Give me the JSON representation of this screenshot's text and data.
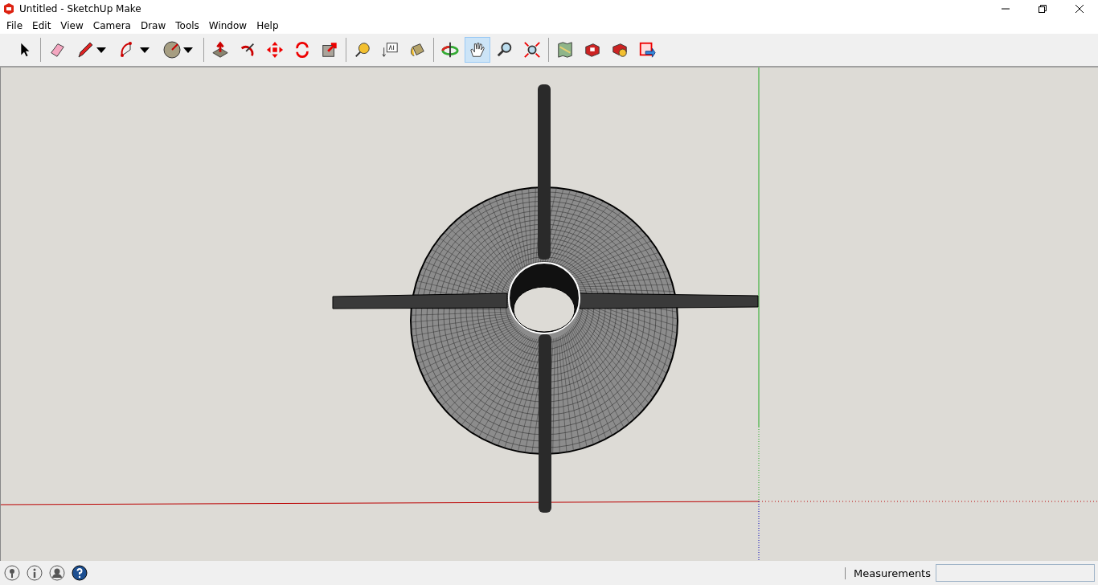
{
  "window": {
    "title": "Untitled - SketchUp Make"
  },
  "menu": [
    "File",
    "Edit",
    "View",
    "Camera",
    "Draw",
    "Tools",
    "Window",
    "Help"
  ],
  "toolbar": {
    "groups": [
      [
        {
          "selected": false,
          "dropdown": false
        }
      ],
      [
        {
          "selected": false,
          "dropdown": false
        },
        {
          "selected": false,
          "dropdown": true
        },
        {
          "selected": false,
          "dropdown": true
        },
        {
          "selected": false,
          "dropdown": true
        }
      ],
      [
        {
          "selected": false,
          "dropdown": false
        },
        {
          "selected": false,
          "dropdown": false
        },
        {
          "selected": false,
          "dropdown": false
        },
        {
          "selected": false,
          "dropdown": false
        },
        {
          "selected": false,
          "dropdown": false
        }
      ],
      [
        {
          "selected": false,
          "dropdown": false
        },
        {
          "selected": false,
          "dropdown": false
        },
        {
          "selected": false,
          "dropdown": false
        }
      ],
      [
        {
          "selected": false,
          "dropdown": false
        },
        {
          "selected": true,
          "dropdown": false
        },
        {
          "selected": false,
          "dropdown": false
        },
        {
          "selected": false,
          "dropdown": false
        }
      ],
      [
        {
          "selected": false,
          "dropdown": false
        },
        {
          "selected": false,
          "dropdown": false
        },
        {
          "selected": false,
          "dropdown": false
        },
        {
          "selected": false,
          "dropdown": false
        }
      ]
    ]
  },
  "status_bar": {
    "measurements_label": "Measurements"
  }
}
